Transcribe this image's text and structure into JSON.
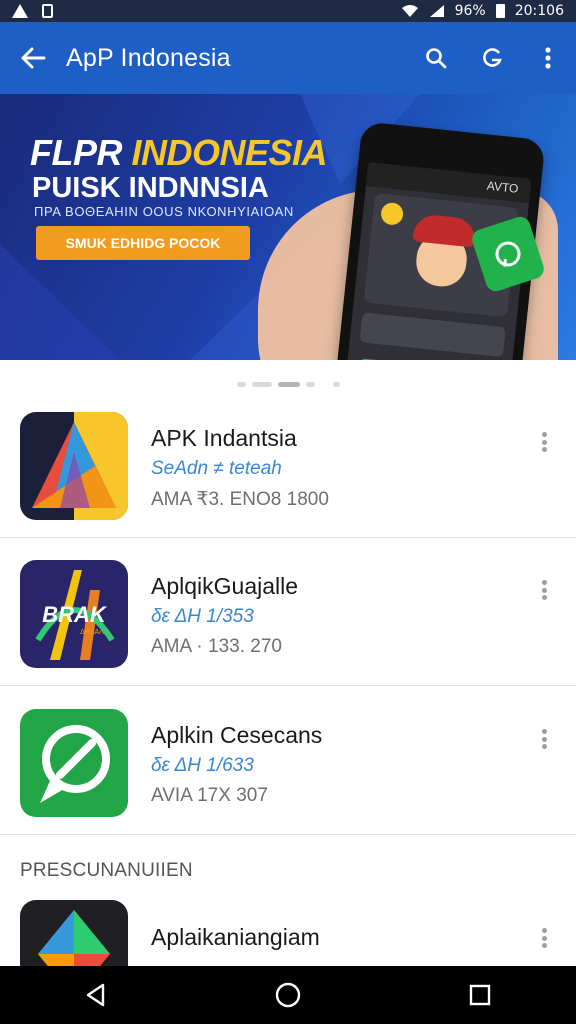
{
  "status_bar": {
    "battery": "96%",
    "time": "20:106"
  },
  "toolbar": {
    "title": "ApP Indonesia"
  },
  "banner": {
    "title_a": "FLPR ",
    "title_accent": "INDONESIA",
    "title_line2": "PUISK INDNNSIA",
    "subtitle": "ΠΡΑ ΒΟΘΕΑΗΙΝ ΟΟUS ΝΚΟΝΗΥΙΑΙΟΑΝ",
    "cta": "SMUK EDHIDG POCOK",
    "phone_status": "AVTO"
  },
  "pager": {
    "count": 5,
    "active": 2
  },
  "apps": [
    {
      "name": "APK Indantsia",
      "developer": "SeAdn ≠ teteah",
      "meta": "AMA ₹3. ENO8 1800",
      "icon": "triangle-logo-icon"
    },
    {
      "name": "AplqikGuajalle",
      "developer": "δε ΔΗ 1/353",
      "meta": "AMA · 133. 270",
      "icon": "brand-logo-icon",
      "logo_text": "BRAK",
      "logo_sub": "ΔΗΧΑΛ"
    },
    {
      "name": "Aplkin Cesecans",
      "developer": "δε ΔΗ 1/633",
      "meta": "AVIA 17Χ 307",
      "icon": "chat-bubble-icon"
    }
  ],
  "section_header": "PRESCUNANUIIEN",
  "partial_app": {
    "name": "Aplaikaniangiam",
    "developer": ""
  }
}
